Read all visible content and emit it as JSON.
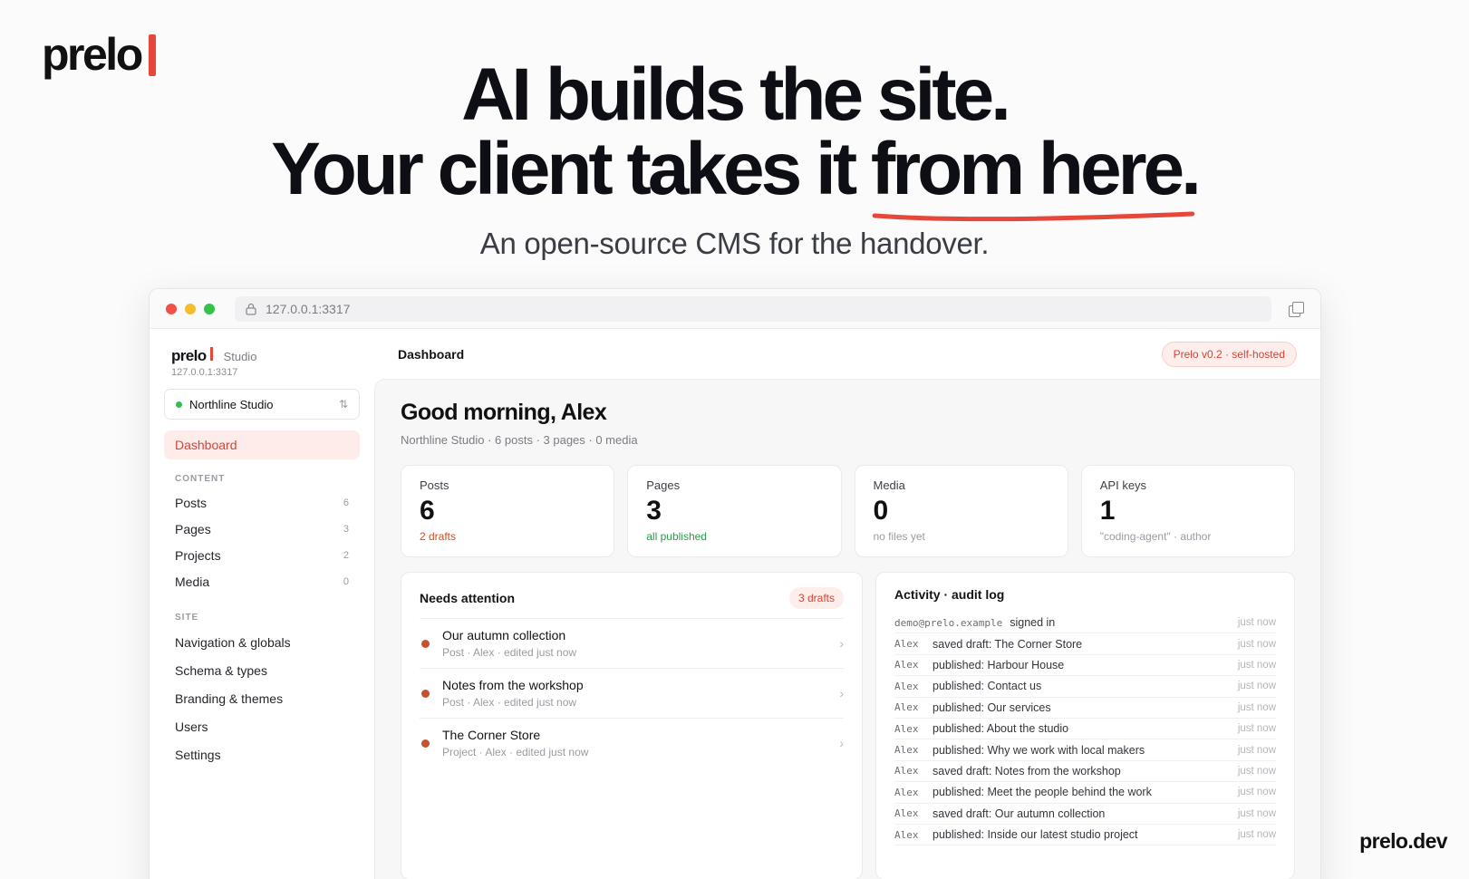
{
  "brand": {
    "name": "prelo",
    "accent": "#e5483a"
  },
  "hero": {
    "line1": "AI builds the site.",
    "line2_start": "Your client takes it ",
    "line2_emph": "from here.",
    "subtitle": "An open-source CMS for the handover."
  },
  "footer": {
    "link": "prelo.dev"
  },
  "browser": {
    "url": "127.0.0.1:3317"
  },
  "sidebar": {
    "brand": "prelo",
    "studio_label": "Studio",
    "host": "127.0.0.1:3317",
    "workspace": "Northline Studio",
    "workspace_switch": "⇅",
    "active": "Dashboard",
    "groups": {
      "content": "CONTENT",
      "site": "SITE"
    },
    "content_items": [
      {
        "label": "Posts",
        "count": "6"
      },
      {
        "label": "Pages",
        "count": "3"
      },
      {
        "label": "Projects",
        "count": "2"
      },
      {
        "label": "Media",
        "count": "0"
      }
    ],
    "site_items": [
      {
        "label": "Navigation & globals"
      },
      {
        "label": "Schema & types"
      },
      {
        "label": "Branding & themes"
      },
      {
        "label": "Users"
      },
      {
        "label": "Settings"
      }
    ]
  },
  "topbar": {
    "title": "Dashboard",
    "version": "Prelo v0.2 · self-hosted"
  },
  "dashboard": {
    "greeting": "Good morning, Alex",
    "meta": "Northline Studio · 6 posts · 3 pages · 0 media",
    "stats": [
      {
        "label": "Posts",
        "value": "6",
        "note": "2 drafts"
      },
      {
        "label": "Pages",
        "value": "3",
        "note": "all published"
      },
      {
        "label": "Media",
        "value": "0",
        "note": "no files yet"
      },
      {
        "label": "API keys",
        "value": "1",
        "note": "\"coding-agent\" · author"
      }
    ],
    "attention": {
      "title": "Needs attention",
      "badge": "3 drafts",
      "items": [
        {
          "title": "Our autumn collection",
          "meta": "Post · Alex · edited just now"
        },
        {
          "title": "Notes from the workshop",
          "meta": "Post · Alex · edited just now"
        },
        {
          "title": "The Corner Store",
          "meta": "Project · Alex · edited just now"
        }
      ]
    },
    "activity": {
      "title": "Activity · audit log",
      "rows": [
        {
          "who": "demo@prelo.example",
          "what": "signed in",
          "when": "just now"
        },
        {
          "who": "Alex",
          "what": "saved draft: The Corner Store",
          "when": "just now"
        },
        {
          "who": "Alex",
          "what": "published: Harbour House",
          "when": "just now"
        },
        {
          "who": "Alex",
          "what": "published: Contact us",
          "when": "just now"
        },
        {
          "who": "Alex",
          "what": "published: Our services",
          "when": "just now"
        },
        {
          "who": "Alex",
          "what": "published: About the studio",
          "when": "just now"
        },
        {
          "who": "Alex",
          "what": "published: Why we work with local makers",
          "when": "just now"
        },
        {
          "who": "Alex",
          "what": "saved draft: Notes from the workshop",
          "when": "just now"
        },
        {
          "who": "Alex",
          "what": "published: Meet the people behind the work",
          "when": "just now"
        },
        {
          "who": "Alex",
          "what": "saved draft: Our autumn collection",
          "when": "just now"
        },
        {
          "who": "Alex",
          "what": "published: Inside our latest studio project",
          "when": "just now"
        }
      ]
    }
  }
}
